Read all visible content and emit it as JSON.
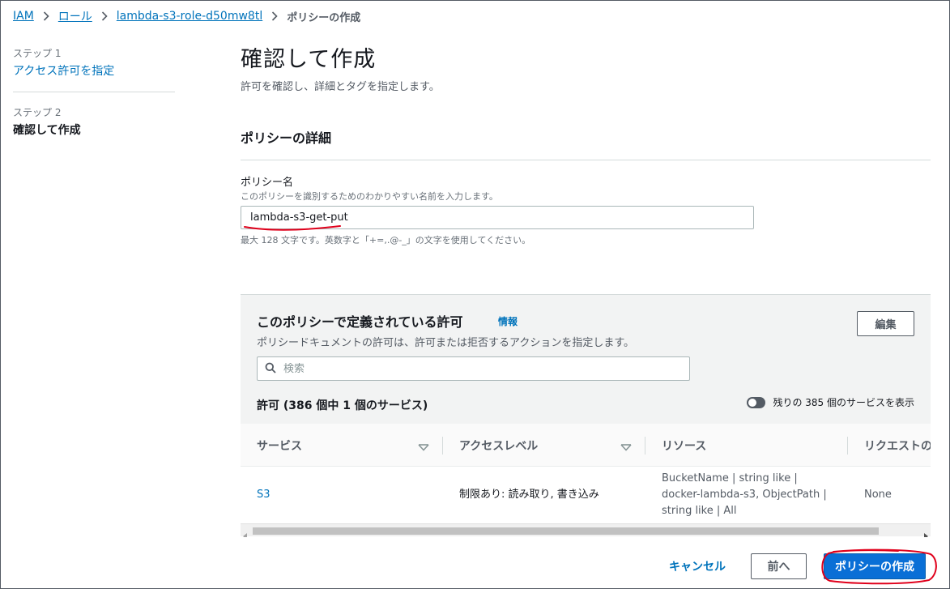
{
  "breadcrumb": {
    "items": [
      "IAM",
      "ロール",
      "lambda-s3-role-d50mw8tl"
    ],
    "current": "ポリシーの作成"
  },
  "steps": {
    "step1_num": "ステップ 1",
    "step1_label": "アクセス許可を指定",
    "step2_num": "ステップ 2",
    "step2_label": "確認して作成"
  },
  "page": {
    "title": "確認して作成",
    "description": "許可を確認し、詳細とタグを指定します。"
  },
  "policy_details": {
    "section_title": "ポリシーの詳細",
    "name_label": "ポリシー名",
    "name_description": "このポリシーを識別するためのわかりやすい名前を入力します。",
    "name_value": "lambda-s3-get-put",
    "name_constraint": "最大 128 文字です。英数字と「+=,.@-_」の文字を使用してください。"
  },
  "permissions": {
    "title": "このポリシーで定義されている許可",
    "info_link": "情報",
    "description": "ポリシードキュメントの許可は、許可または拒否するアクションを指定します。",
    "edit_label": "編集",
    "search_placeholder": "検索",
    "allow_title": "許可 (386 個中 1 個のサービス)",
    "toggle_label": "残りの 385 個のサービスを表示",
    "columns": [
      "サービス",
      "アクセスレベル",
      "リソース",
      "リクエストの"
    ],
    "rows": [
      {
        "service": "S3",
        "access": "制限あり: 読み取り, 書き込み",
        "resource": "BucketName | string like | docker-lambda-s3, ObjectPath | string like | All",
        "request": "None"
      }
    ]
  },
  "footer": {
    "cancel_label": "キャンセル",
    "prev_label": "前へ",
    "create_label": "ポリシーの作成"
  },
  "colors": {
    "link": "#0073bb",
    "primary_button": "#0a6fd6",
    "annotation": "#e0001b"
  }
}
